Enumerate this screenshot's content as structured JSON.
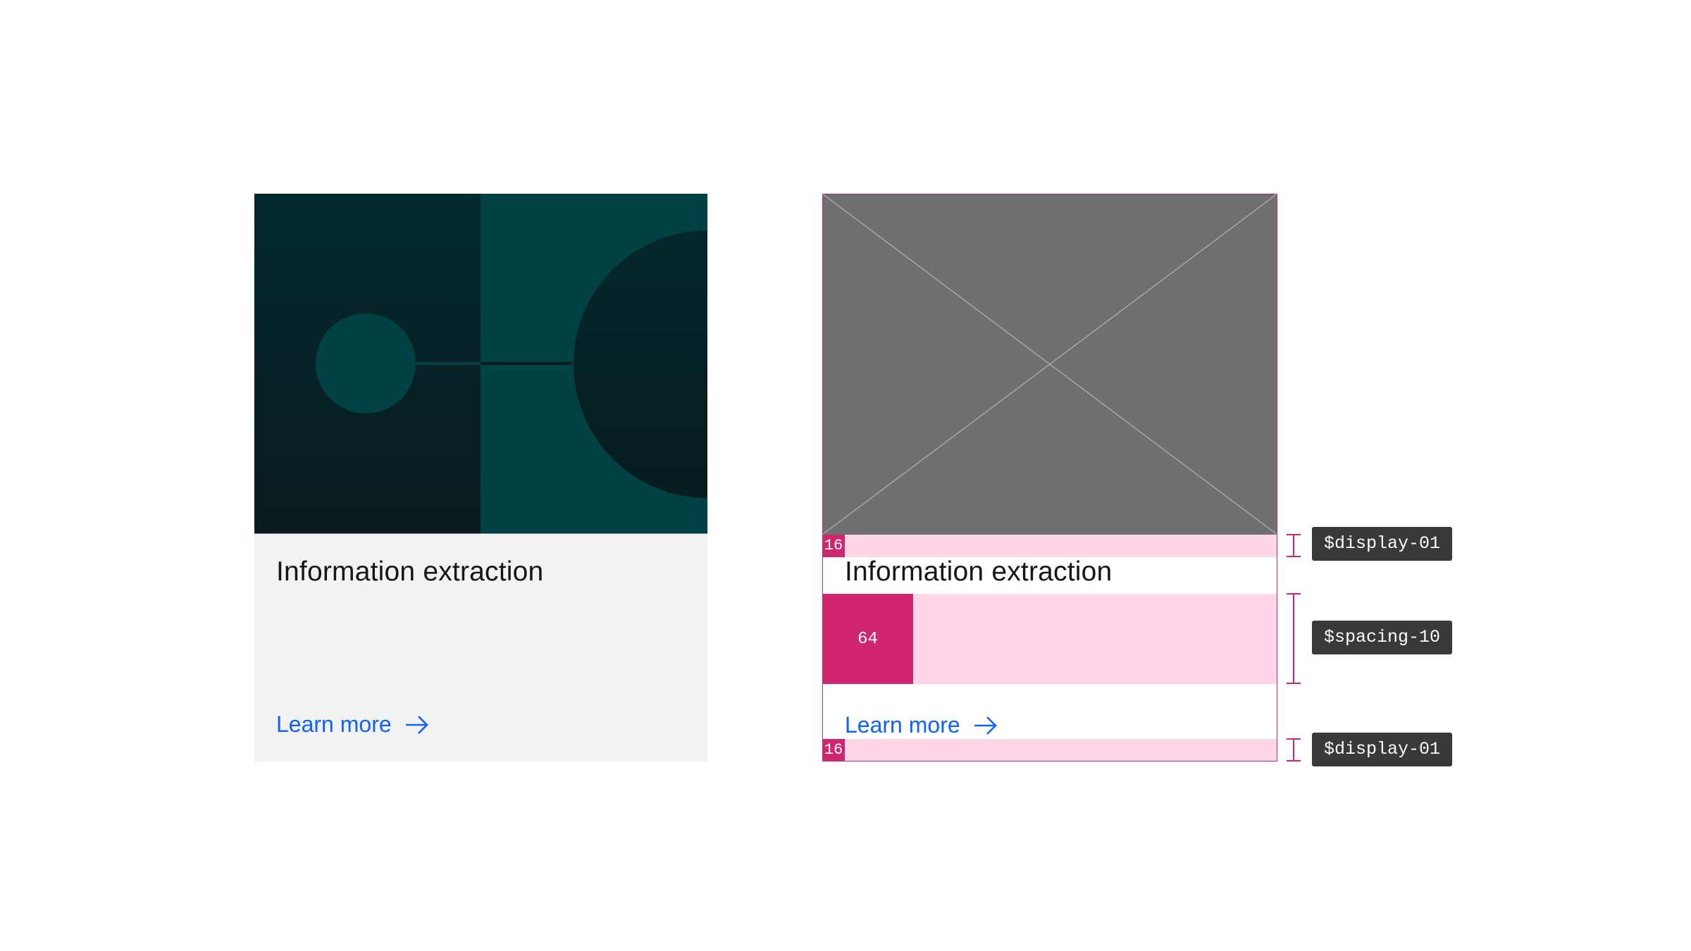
{
  "left_card": {
    "title": "Information extraction",
    "link_label": "Learn more",
    "colors": {
      "background": "#f2f2f2",
      "hero_dark": "#062025",
      "hero_teal": "#004144",
      "link": "#0f62fe"
    }
  },
  "right_card": {
    "title": "Information extraction",
    "link_label": "Learn more",
    "spacing_top": "16",
    "spacing_middle": "64",
    "spacing_bottom": "16",
    "colors": {
      "placeholder": "#6f6f6f",
      "spec_pink": "#d02670",
      "spec_pink_light": "#ffd6e8"
    }
  },
  "tokens": {
    "top": "$display-01",
    "middle": "$spacing-10",
    "bottom": "$display-01"
  },
  "icons": [
    "arrow-right-icon",
    "image-placeholder-icon"
  ]
}
